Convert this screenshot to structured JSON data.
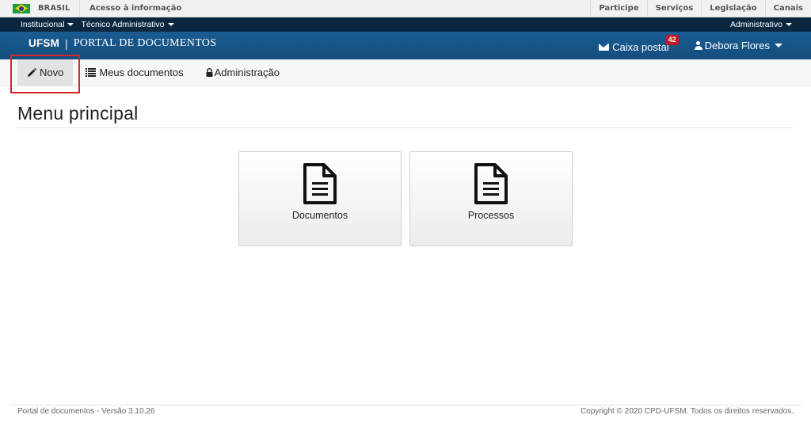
{
  "govbar": {
    "brasil": "BRASIL",
    "acesso": "Acesso à informação",
    "links": [
      "Participe",
      "Serviços",
      "Legislação",
      "Canais"
    ]
  },
  "topbar": {
    "left": [
      "Institucional",
      "Técnico Administrativo"
    ],
    "right": "Administrativo"
  },
  "header": {
    "brand": "UFSM",
    "separator": "|",
    "portal": "PORTAL DE DOCUMENTOS",
    "inbox_label": "Caixa postal",
    "inbox_count": "42",
    "user_name": "Debora Flores"
  },
  "nav": {
    "novo": "Novo",
    "meus": "Meus documentos",
    "admin": "Administração"
  },
  "main": {
    "title": "Menu principal",
    "tiles": [
      "Documentos",
      "Processos"
    ]
  },
  "footer": {
    "version": "Portal de documentos - Versão 3.10.26",
    "copyright": "Copyright © 2020 CPD-UFSM. Todos os direitos reservados."
  },
  "colors": {
    "header": "#1a5c92",
    "darkbar": "#0b2740",
    "highlight": "#d6242c",
    "badge": "#c9161c"
  },
  "icons": [
    "brazil-flag-icon",
    "pencil-icon",
    "list-icon",
    "lock-icon",
    "envelope-icon",
    "user-icon",
    "document-icon"
  ]
}
